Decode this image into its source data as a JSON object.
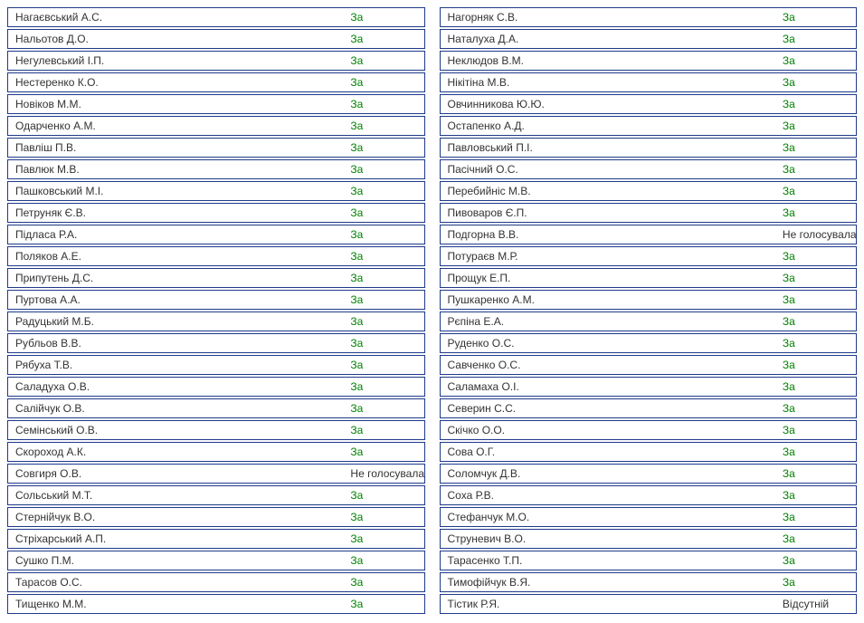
{
  "left": [
    {
      "name": "Нагаєвський А.С.",
      "vote": "За",
      "cls": "v-za"
    },
    {
      "name": "Нальотов Д.О.",
      "vote": "За",
      "cls": "v-za"
    },
    {
      "name": "Негулевський І.П.",
      "vote": "За",
      "cls": "v-za"
    },
    {
      "name": "Нестеренко К.О.",
      "vote": "За",
      "cls": "v-za"
    },
    {
      "name": "Новіков М.М.",
      "vote": "За",
      "cls": "v-za"
    },
    {
      "name": "Одарченко А.М.",
      "vote": "За",
      "cls": "v-za"
    },
    {
      "name": "Павліш П.В.",
      "vote": "За",
      "cls": "v-za"
    },
    {
      "name": "Павлюк М.В.",
      "vote": "За",
      "cls": "v-za"
    },
    {
      "name": "Пашковський М.І.",
      "vote": "За",
      "cls": "v-za"
    },
    {
      "name": "Петруняк Є.В.",
      "vote": "За",
      "cls": "v-za"
    },
    {
      "name": "Підласа Р.А.",
      "vote": "За",
      "cls": "v-za"
    },
    {
      "name": "Поляков А.Е.",
      "vote": "За",
      "cls": "v-za"
    },
    {
      "name": "Припутень Д.С.",
      "vote": "За",
      "cls": "v-za"
    },
    {
      "name": "Пуртова А.А.",
      "vote": "За",
      "cls": "v-za"
    },
    {
      "name": "Радуцький М.Б.",
      "vote": "За",
      "cls": "v-za"
    },
    {
      "name": "Рубльов В.В.",
      "vote": "За",
      "cls": "v-za"
    },
    {
      "name": "Рябуха Т.В.",
      "vote": "За",
      "cls": "v-za"
    },
    {
      "name": "Саладуха О.В.",
      "vote": "За",
      "cls": "v-za"
    },
    {
      "name": "Салійчук О.В.",
      "vote": "За",
      "cls": "v-za"
    },
    {
      "name": "Семінський О.В.",
      "vote": "За",
      "cls": "v-za"
    },
    {
      "name": "Скороход А.К.",
      "vote": "За",
      "cls": "v-za"
    },
    {
      "name": "Совгиря О.В.",
      "vote": "Не голосувала",
      "cls": "v-no"
    },
    {
      "name": "Сольський М.Т.",
      "vote": "За",
      "cls": "v-za"
    },
    {
      "name": "Стернійчук В.О.",
      "vote": "За",
      "cls": "v-za"
    },
    {
      "name": "Стріхарський А.П.",
      "vote": "За",
      "cls": "v-za"
    },
    {
      "name": "Сушко П.М.",
      "vote": "За",
      "cls": "v-za"
    },
    {
      "name": "Тарасов О.С.",
      "vote": "За",
      "cls": "v-za"
    },
    {
      "name": "Тищенко М.М.",
      "vote": "За",
      "cls": "v-za"
    }
  ],
  "right": [
    {
      "name": "Нагорняк С.В.",
      "vote": "За",
      "cls": "v-za"
    },
    {
      "name": "Наталуха Д.А.",
      "vote": "За",
      "cls": "v-za"
    },
    {
      "name": "Неклюдов В.М.",
      "vote": "За",
      "cls": "v-za"
    },
    {
      "name": "Нікітіна М.В.",
      "vote": "За",
      "cls": "v-za"
    },
    {
      "name": "Овчинникова Ю.Ю.",
      "vote": "За",
      "cls": "v-za"
    },
    {
      "name": "Остапенко А.Д.",
      "vote": "За",
      "cls": "v-za"
    },
    {
      "name": "Павловський П.І.",
      "vote": "За",
      "cls": "v-za"
    },
    {
      "name": "Пасічний О.С.",
      "vote": "За",
      "cls": "v-za"
    },
    {
      "name": "Перебийніс М.В.",
      "vote": "За",
      "cls": "v-za"
    },
    {
      "name": "Пивоваров Є.П.",
      "vote": "За",
      "cls": "v-za"
    },
    {
      "name": "Подгорна В.В.",
      "vote": "Не голосувала",
      "cls": "v-no"
    },
    {
      "name": "Потураєв М.Р.",
      "vote": "За",
      "cls": "v-za"
    },
    {
      "name": "Прощук Е.П.",
      "vote": "За",
      "cls": "v-za"
    },
    {
      "name": "Пушкаренко А.М.",
      "vote": "За",
      "cls": "v-za"
    },
    {
      "name": "Рєпіна Е.А.",
      "vote": "За",
      "cls": "v-za"
    },
    {
      "name": "Руденко О.С.",
      "vote": "За",
      "cls": "v-za"
    },
    {
      "name": "Савченко О.С.",
      "vote": "За",
      "cls": "v-za"
    },
    {
      "name": "Саламаха О.І.",
      "vote": "За",
      "cls": "v-za"
    },
    {
      "name": "Северин С.С.",
      "vote": "За",
      "cls": "v-za"
    },
    {
      "name": "Скічко О.О.",
      "vote": "За",
      "cls": "v-za"
    },
    {
      "name": "Сова О.Г.",
      "vote": "За",
      "cls": "v-za"
    },
    {
      "name": "Соломчук Д.В.",
      "vote": "За",
      "cls": "v-za"
    },
    {
      "name": "Соха Р.В.",
      "vote": "За",
      "cls": "v-za"
    },
    {
      "name": "Стефанчук М.О.",
      "vote": "За",
      "cls": "v-za"
    },
    {
      "name": "Струневич В.О.",
      "vote": "За",
      "cls": "v-za"
    },
    {
      "name": "Тарасенко Т.П.",
      "vote": "За",
      "cls": "v-za"
    },
    {
      "name": "Тимофійчук В.Я.",
      "vote": "За",
      "cls": "v-za"
    },
    {
      "name": "Тістик Р.Я.",
      "vote": "Відсутній",
      "cls": "v-ab"
    }
  ]
}
